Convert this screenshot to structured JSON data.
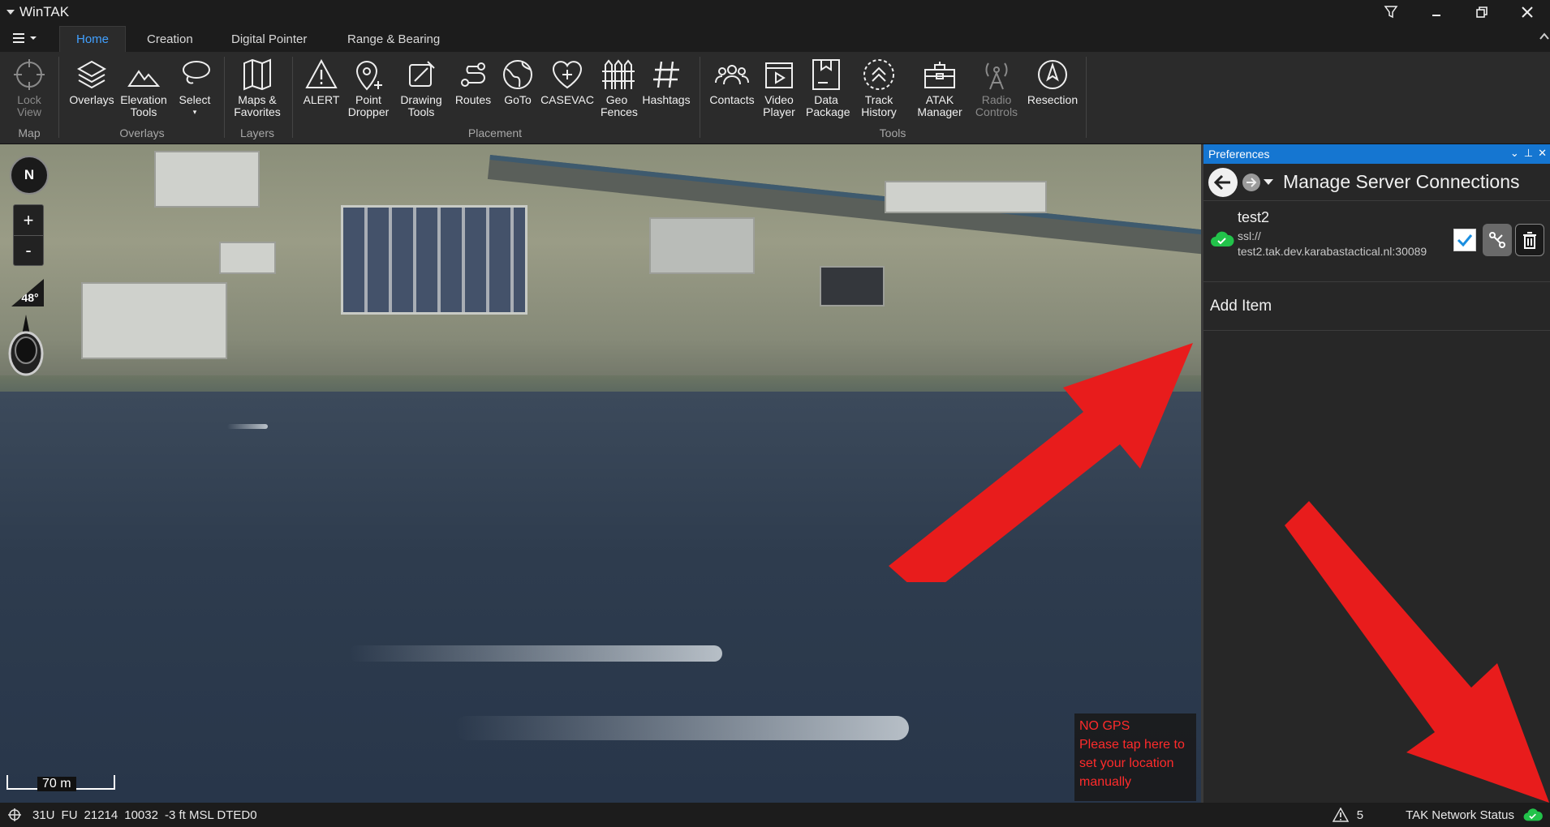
{
  "window": {
    "title": "WinTAK"
  },
  "tabs": [
    {
      "label": "Home",
      "active": true
    },
    {
      "label": "Creation",
      "active": false
    },
    {
      "label": "Digital Pointer",
      "active": false
    },
    {
      "label": "Range & Bearing",
      "active": false
    }
  ],
  "ribbon": {
    "lock_view": "Lock View",
    "overlays": "Overlays",
    "elevation_tools": "Elevation Tools",
    "select": "Select",
    "maps_favorites": "Maps & Favorites",
    "alert": "ALERT",
    "point_dropper": "Point Dropper",
    "drawing_tools": "Drawing Tools",
    "routes": "Routes",
    "goto": "GoTo",
    "casevac": "CASEVAC",
    "geo_fences": "Geo Fences",
    "hashtags": "Hashtags",
    "contacts": "Contacts",
    "video_player": "Video Player",
    "data_package": "Data Package",
    "track_history": "Track History",
    "atak_manager": "ATAK Manager",
    "radio_controls": "Radio Controls",
    "resection": "Resection",
    "groups": {
      "map": "Map",
      "overlays": "Overlays",
      "layers": "Layers",
      "placement": "Placement",
      "tools": "Tools"
    }
  },
  "map": {
    "compass_label": "N",
    "zoom_in": "+",
    "zoom_out": "-",
    "tilt": "48°",
    "scale_label": "70 m",
    "no_gps": {
      "line1": "NO GPS",
      "line2": "Please tap here to set your location manually"
    }
  },
  "preferences": {
    "panel_title": "Preferences",
    "heading": "Manage Server Connections",
    "server": {
      "name": "test2",
      "protocol": "ssl://",
      "host": "test2.tak.dev.karabastactical.nl:30089",
      "enabled": true,
      "status_color": "#22c24a"
    },
    "add_item": "Add Item"
  },
  "status_bar": {
    "grid_zone": "31U",
    "square": "FU",
    "easting": "21214",
    "northing": "10032",
    "elevation": "-3 ft MSL DTED0",
    "alert_count": "5",
    "network_status": "TAK Network Status"
  },
  "colors": {
    "accent": "#41a0ff",
    "panel_title": "#1576d1",
    "annotation": "#e81c1c",
    "connected": "#22c24a",
    "warning_text": "#ff2b2b"
  }
}
